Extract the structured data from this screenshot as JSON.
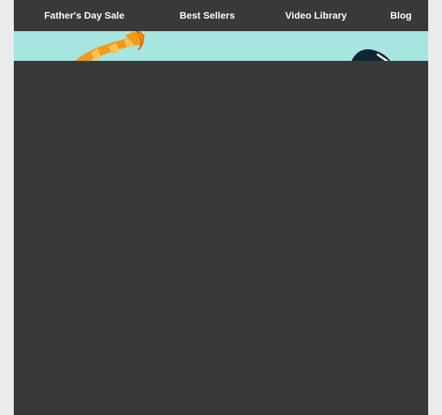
{
  "nav": {
    "items": [
      {
        "label": "Father's Day Sale"
      },
      {
        "label": "Best Sellers"
      },
      {
        "label": "Video Library"
      },
      {
        "label": "Blog"
      }
    ]
  },
  "colors": {
    "page_background": "#ececec",
    "nav_background": "#393939",
    "nav_text": "#ffffff",
    "hero_background": "#a6e6e0",
    "tie_orange": "#f39a1a",
    "tie_stripe": "#ffc35c",
    "dark_object": "#0f2533"
  },
  "hero": {
    "icons": [
      "necktie-icon",
      "dark-object-icon"
    ]
  }
}
